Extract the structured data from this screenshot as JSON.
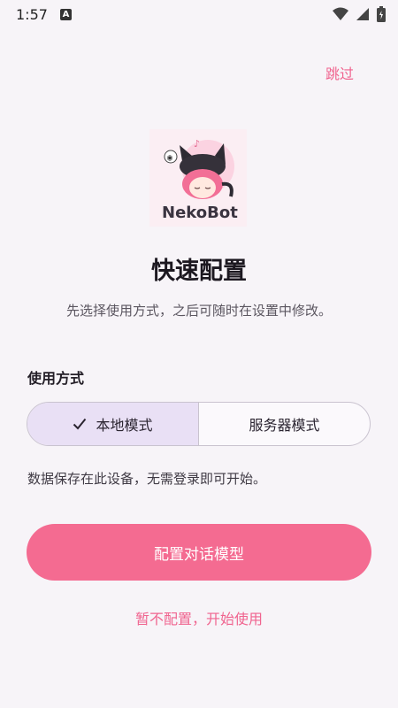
{
  "status_bar": {
    "time": "1:57",
    "a_badge": "A",
    "icons": [
      "wifi-icon",
      "signal-icon",
      "battery-icon"
    ]
  },
  "header": {
    "skip_label": "跳过"
  },
  "logo": {
    "text": "NekoBot"
  },
  "main": {
    "title": "快速配置",
    "subtitle": "先选择使用方式，之后可随时在设置中修改。",
    "section_label": "使用方式",
    "modes": [
      {
        "label": "本地模式",
        "selected": true
      },
      {
        "label": "服务器模式",
        "selected": false
      }
    ],
    "mode_description": "数据保存在此设备，无需登录即可开始。",
    "primary_button": "配置对话模型",
    "secondary_button": "暂不配置，开始使用"
  },
  "colors": {
    "accent": "#f46b91",
    "selected_segment": "#e9e0f5",
    "background": "#f7f4f8"
  }
}
